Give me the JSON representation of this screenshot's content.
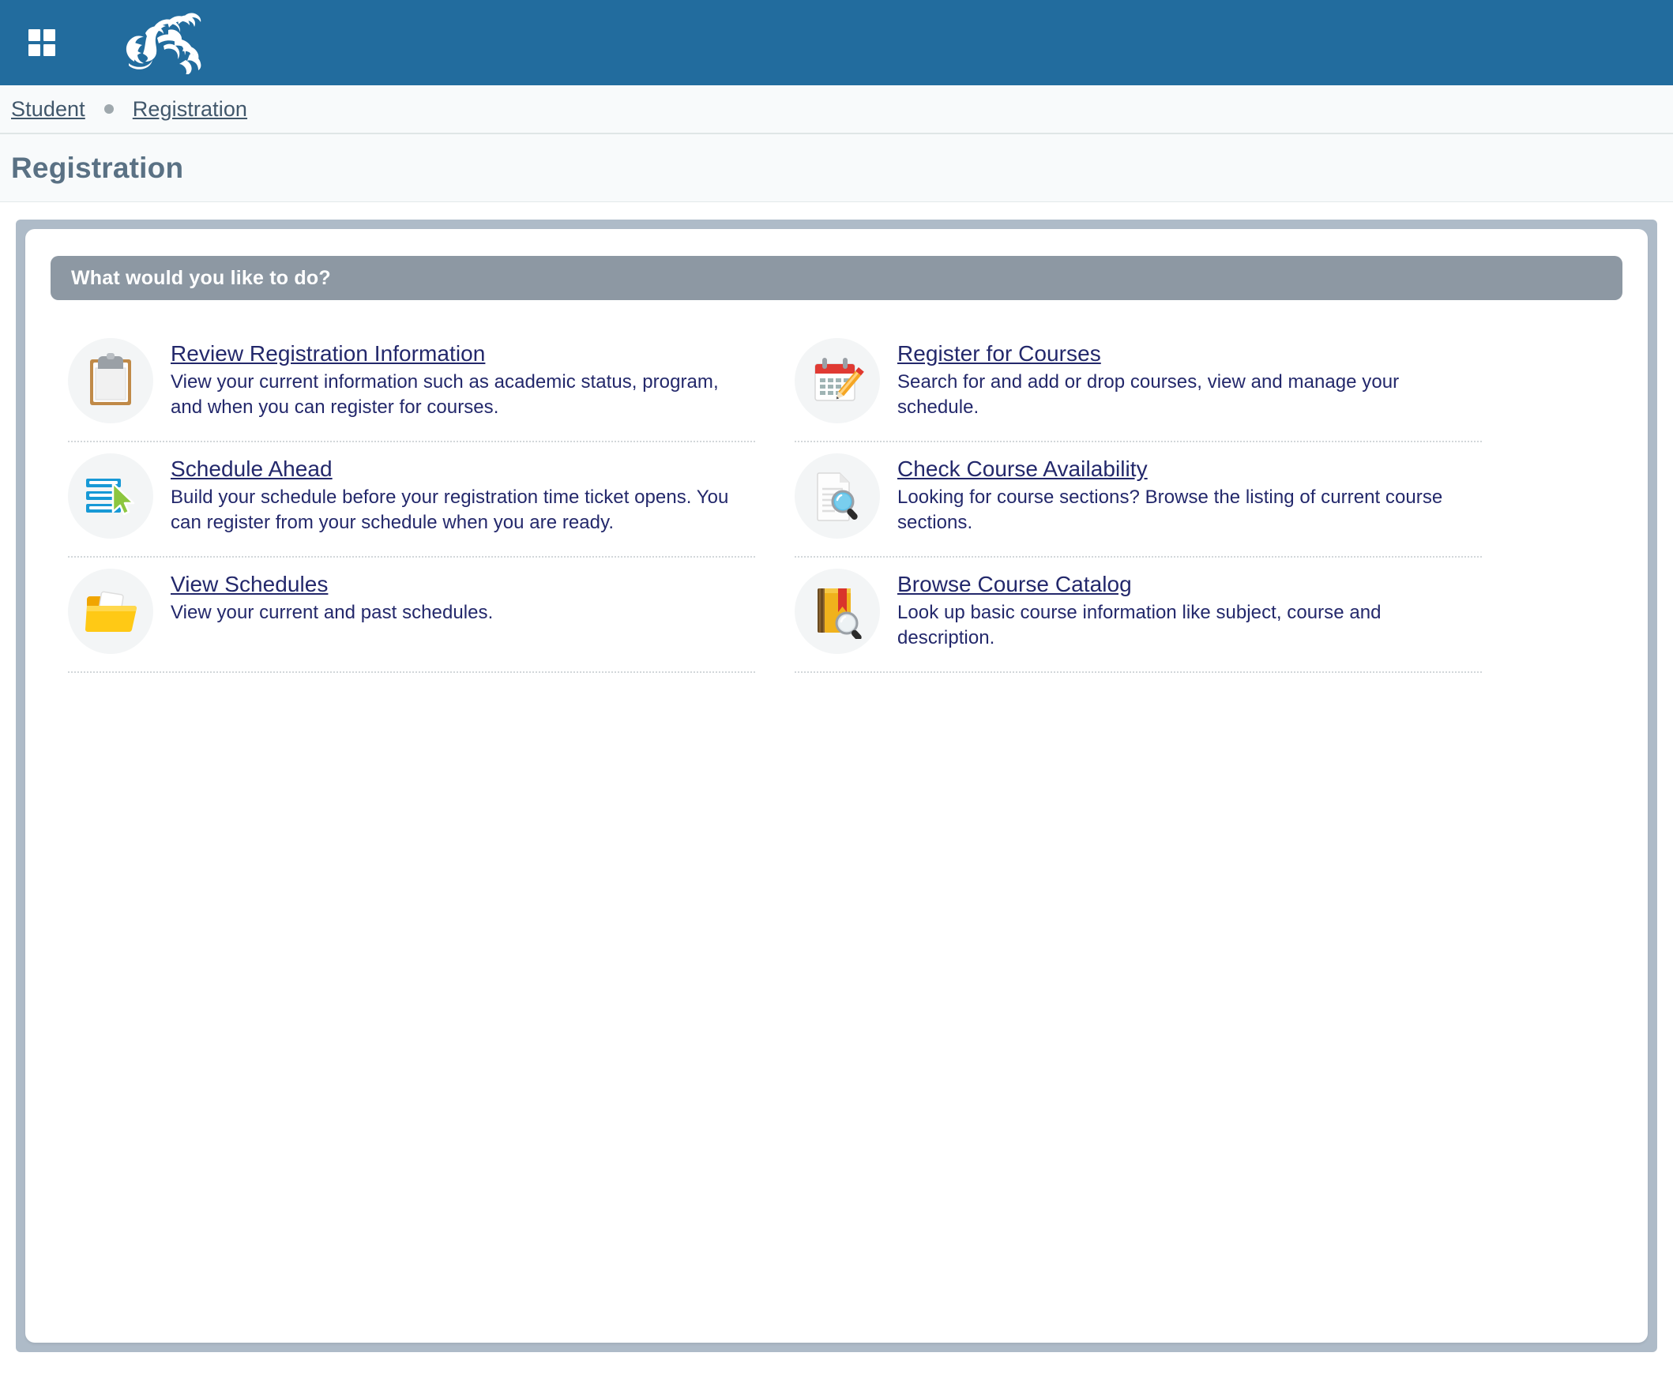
{
  "header": {
    "menu_icon": "grid-menu-icon",
    "logo_icon": "dragon-logo",
    "background_color": "#226c9e"
  },
  "breadcrumb": {
    "items": [
      {
        "label": "Student"
      },
      {
        "label": "Registration"
      }
    ],
    "separator_icon": "dot-separator-icon"
  },
  "page": {
    "title": "Registration"
  },
  "panel": {
    "section_header": "What would you like to do?",
    "header_color": "#8d98a3",
    "frame_color": "#aebbc8"
  },
  "cards": [
    {
      "icon": "clipboard-icon",
      "title": "Review Registration Information",
      "description": "View your current information such as academic status, program, and when you can register for courses."
    },
    {
      "icon": "calendar-pencil-icon",
      "title": "Register for Courses",
      "description": "Search for and add or drop courses, view and manage your schedule."
    },
    {
      "icon": "schedule-bars-cursor-icon",
      "title": "Schedule Ahead",
      "description": "Build your schedule before your registration time ticket opens. You can register from your schedule when you are ready."
    },
    {
      "icon": "document-magnifier-icon",
      "title": "Check Course Availability",
      "description": "Looking for course sections? Browse the listing of current course sections."
    },
    {
      "icon": "folder-icon",
      "title": "View Schedules",
      "description": "View your current and past schedules."
    },
    {
      "icon": "book-magnifier-icon",
      "title": "Browse Course Catalog",
      "description": "Look up basic course information like subject, course and description."
    }
  ]
}
